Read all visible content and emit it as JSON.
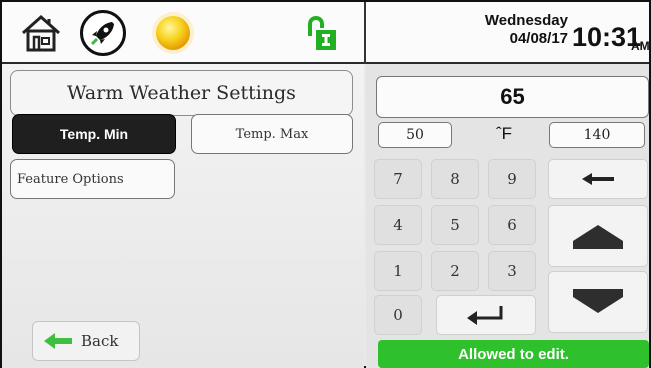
{
  "header": {
    "icons": [
      "home-icon",
      "rocket-icon",
      "sun-icon",
      "unlock-icon"
    ],
    "date_day": "Wednesday",
    "date_num": "04/08/17",
    "time": "10:31",
    "ampm": "AM"
  },
  "left": {
    "title": "Warm Weather Settings",
    "tab_min": "Temp. Min",
    "tab_max": "Temp. Max",
    "feature_options": "Feature Options",
    "back": "Back"
  },
  "right": {
    "value": "65",
    "range_min": "50",
    "unit": "ˆF",
    "range_max": "140",
    "keys": [
      "7",
      "8",
      "9",
      "4",
      "5",
      "6",
      "1",
      "2",
      "3",
      "0"
    ],
    "status": "Allowed to edit."
  },
  "colors": {
    "status_green": "#2fc12c",
    "active_tab": "#1f1f1f",
    "back_arrow": "#3fbf3f"
  }
}
